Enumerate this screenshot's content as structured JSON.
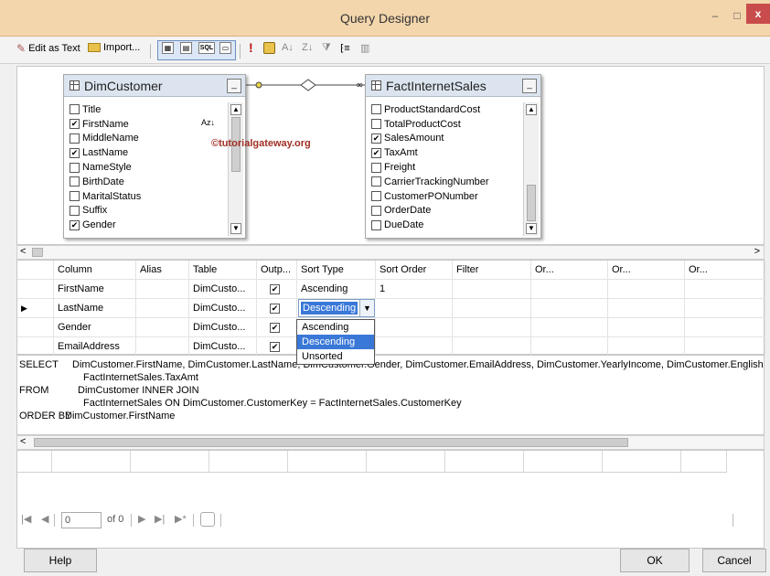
{
  "window": {
    "title": "Query Designer",
    "minimize_glyph": "–",
    "maximize_glyph": "□",
    "close_glyph": "x"
  },
  "toolbar": {
    "edit_as_text": "Edit as Text",
    "import": "Import...",
    "sql_icon": "SQL",
    "run_glyph": "!"
  },
  "diagram": {
    "watermark": "©tutorialgateway.org",
    "tables": [
      {
        "name": "DimCustomer",
        "sort_glyph": "Az↓",
        "fields": [
          {
            "name": "Title",
            "checked": false
          },
          {
            "name": "FirstName",
            "checked": true
          },
          {
            "name": "MiddleName",
            "checked": false
          },
          {
            "name": "LastName",
            "checked": true
          },
          {
            "name": "NameStyle",
            "checked": false
          },
          {
            "name": "BirthDate",
            "checked": false
          },
          {
            "name": "MaritalStatus",
            "checked": false
          },
          {
            "name": "Suffix",
            "checked": false
          },
          {
            "name": "Gender",
            "checked": true
          }
        ]
      },
      {
        "name": "FactInternetSales",
        "fields": [
          {
            "name": "ProductStandardCost",
            "checked": false
          },
          {
            "name": "TotalProductCost",
            "checked": false
          },
          {
            "name": "SalesAmount",
            "checked": true
          },
          {
            "name": "TaxAmt",
            "checked": true
          },
          {
            "name": "Freight",
            "checked": false
          },
          {
            "name": "CarrierTrackingNumber",
            "checked": false
          },
          {
            "name": "CustomerPONumber",
            "checked": false
          },
          {
            "name": "OrderDate",
            "checked": false
          },
          {
            "name": "DueDate",
            "checked": false
          }
        ]
      }
    ]
  },
  "grid": {
    "headers": [
      "Column",
      "Alias",
      "Table",
      "Outp...",
      "Sort Type",
      "Sort Order",
      "Filter",
      "Or...",
      "Or...",
      "Or..."
    ],
    "rows": [
      {
        "column": "FirstName",
        "alias": "",
        "table": "DimCusto...",
        "output": true,
        "sort_type": "Ascending",
        "sort_order": "1",
        "current": false
      },
      {
        "column": "LastName",
        "alias": "",
        "table": "DimCusto...",
        "output": true,
        "sort_type": "Descending",
        "sort_order": "",
        "current": true
      },
      {
        "column": "Gender",
        "alias": "",
        "table": "DimCusto...",
        "output": true,
        "sort_type": "",
        "sort_order": "",
        "current": false
      },
      {
        "column": "EmailAddress",
        "alias": "",
        "table": "DimCusto...",
        "output": true,
        "sort_type": "",
        "sort_order": "",
        "current": false
      }
    ],
    "sort_dropdown": {
      "selected": "Descending",
      "options": [
        "Ascending",
        "Descending",
        "Unsorted"
      ]
    }
  },
  "sql": {
    "lines": [
      {
        "keyword": "SELECT",
        "text": "DimCustomer.FirstName, DimCustomer.LastName, DimCustomer.Gender, DimCustomer.EmailAddress, DimCustomer.YearlyIncome, DimCustomer.EnglishE"
      },
      {
        "keyword": "",
        "text": "FactInternetSales.TaxAmt"
      },
      {
        "keyword": "FROM",
        "text": "DimCustomer INNER JOIN"
      },
      {
        "keyword": "",
        "text": "FactInternetSales ON DimCustomer.CustomerKey = FactInternetSales.CustomerKey"
      },
      {
        "keyword": "ORDER BY",
        "text": "DimCustomer.FirstName"
      }
    ]
  },
  "results": {
    "page_value": "0",
    "page_of": "of 0"
  },
  "footer": {
    "help": "Help",
    "ok": "OK",
    "cancel": "Cancel"
  }
}
